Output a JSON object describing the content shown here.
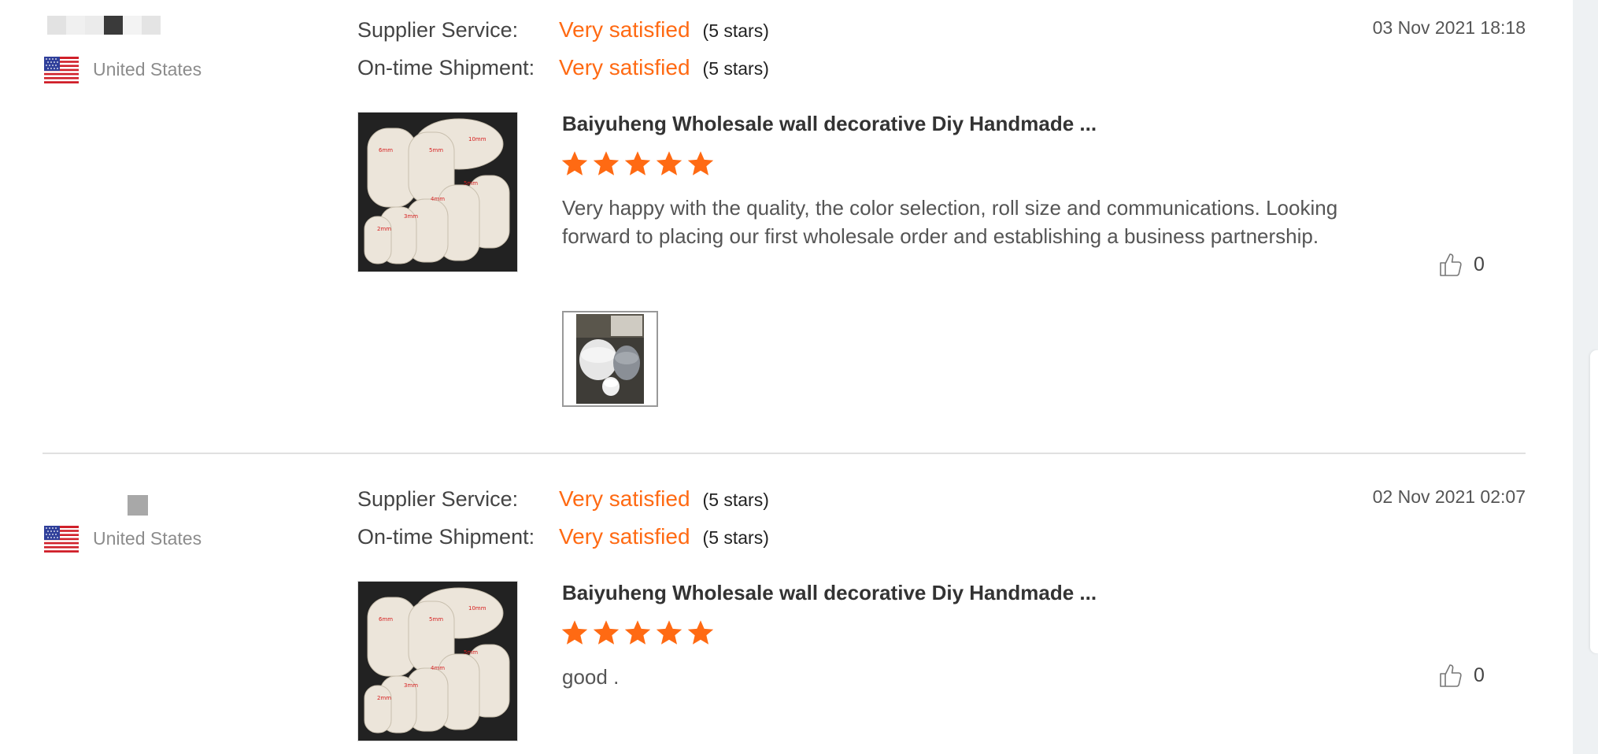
{
  "reviews": [
    {
      "country": "United States",
      "supplier_service_label": "Supplier Service:",
      "supplier_service_value": "Very satisfied",
      "supplier_service_stars": "(5 stars)",
      "shipment_label": "On-time Shipment:",
      "shipment_value": "Very satisfied",
      "shipment_stars": "(5 stars)",
      "date": "03 Nov 2021 18:18",
      "product_title": "Baiyuheng Wholesale wall decorative Diy Handmade ...",
      "rating": 5,
      "comment": "Very happy with the quality, the color selection, roll size and communications.  Looking forward to placing our first wholesale order and establishing a business partnership.",
      "likes": "0",
      "has_attachment": true
    },
    {
      "country": "United States",
      "supplier_service_label": "Supplier Service:",
      "supplier_service_value": "Very satisfied",
      "supplier_service_stars": "(5 stars)",
      "shipment_label": "On-time Shipment:",
      "shipment_value": "Very satisfied",
      "shipment_stars": "(5 stars)",
      "date": "02 Nov 2021 02:07",
      "product_title": "Baiyuheng Wholesale wall decorative Diy Handmade ...",
      "rating": 5,
      "comment": "good .",
      "likes": "0",
      "has_attachment": false
    }
  ],
  "product_image_labels": [
    "6mm",
    "5mm",
    "10mm",
    "5mm",
    "4mm",
    "3mm",
    "2mm"
  ],
  "icons": {
    "flag": "us-flag-icon",
    "star": "star-icon",
    "like": "thumbs-up-icon"
  },
  "colors": {
    "accent": "#ff6a13",
    "star": "#ff6a13"
  }
}
